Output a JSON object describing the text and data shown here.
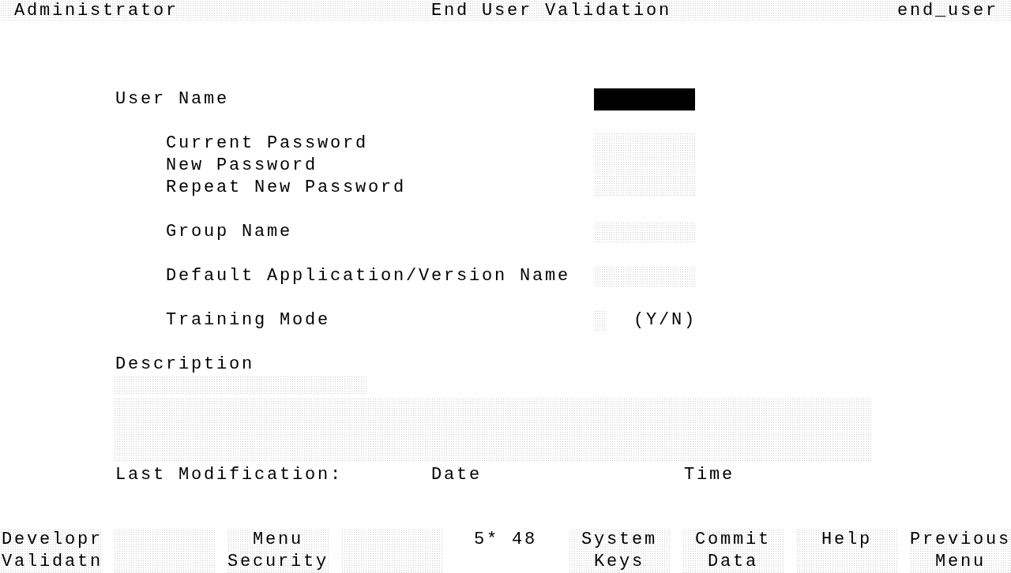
{
  "header": {
    "role": "Administrator",
    "title": "End User Validation",
    "screen": "end_user"
  },
  "user_name": {
    "label": "User Name",
    "active": true
  },
  "password_fields": [
    {
      "label": "Current Password"
    },
    {
      "label": "New Password"
    },
    {
      "label": "Repeat New Password"
    }
  ],
  "group_name": {
    "label": "Group Name",
    "active": false
  },
  "default_application": {
    "label": "Default Application/Version Name",
    "active": false
  },
  "training_mode": {
    "label": "Training Mode",
    "hint": "(Y/N)",
    "active": false
  },
  "description": {
    "label": "Description"
  },
  "last_modification": {
    "label": "Last Modification:",
    "date_label": "Date",
    "time_label": "Time"
  },
  "function_keys": [
    {
      "kind": "label_left",
      "lines": [
        "Developr",
        "Validatn"
      ]
    },
    {
      "kind": "blank"
    },
    {
      "kind": "label",
      "lines": [
        "Menu",
        "Security"
      ]
    },
    {
      "kind": "blank"
    },
    {
      "kind": "status",
      "lines": [
        "5* 48"
      ]
    },
    {
      "kind": "label",
      "lines": [
        "System",
        "Keys"
      ]
    },
    {
      "kind": "label",
      "lines": [
        "Commit",
        "Data"
      ]
    },
    {
      "kind": "label",
      "lines": [
        "Help"
      ]
    },
    {
      "kind": "label",
      "lines": [
        "Previous",
        "Menu"
      ]
    }
  ]
}
